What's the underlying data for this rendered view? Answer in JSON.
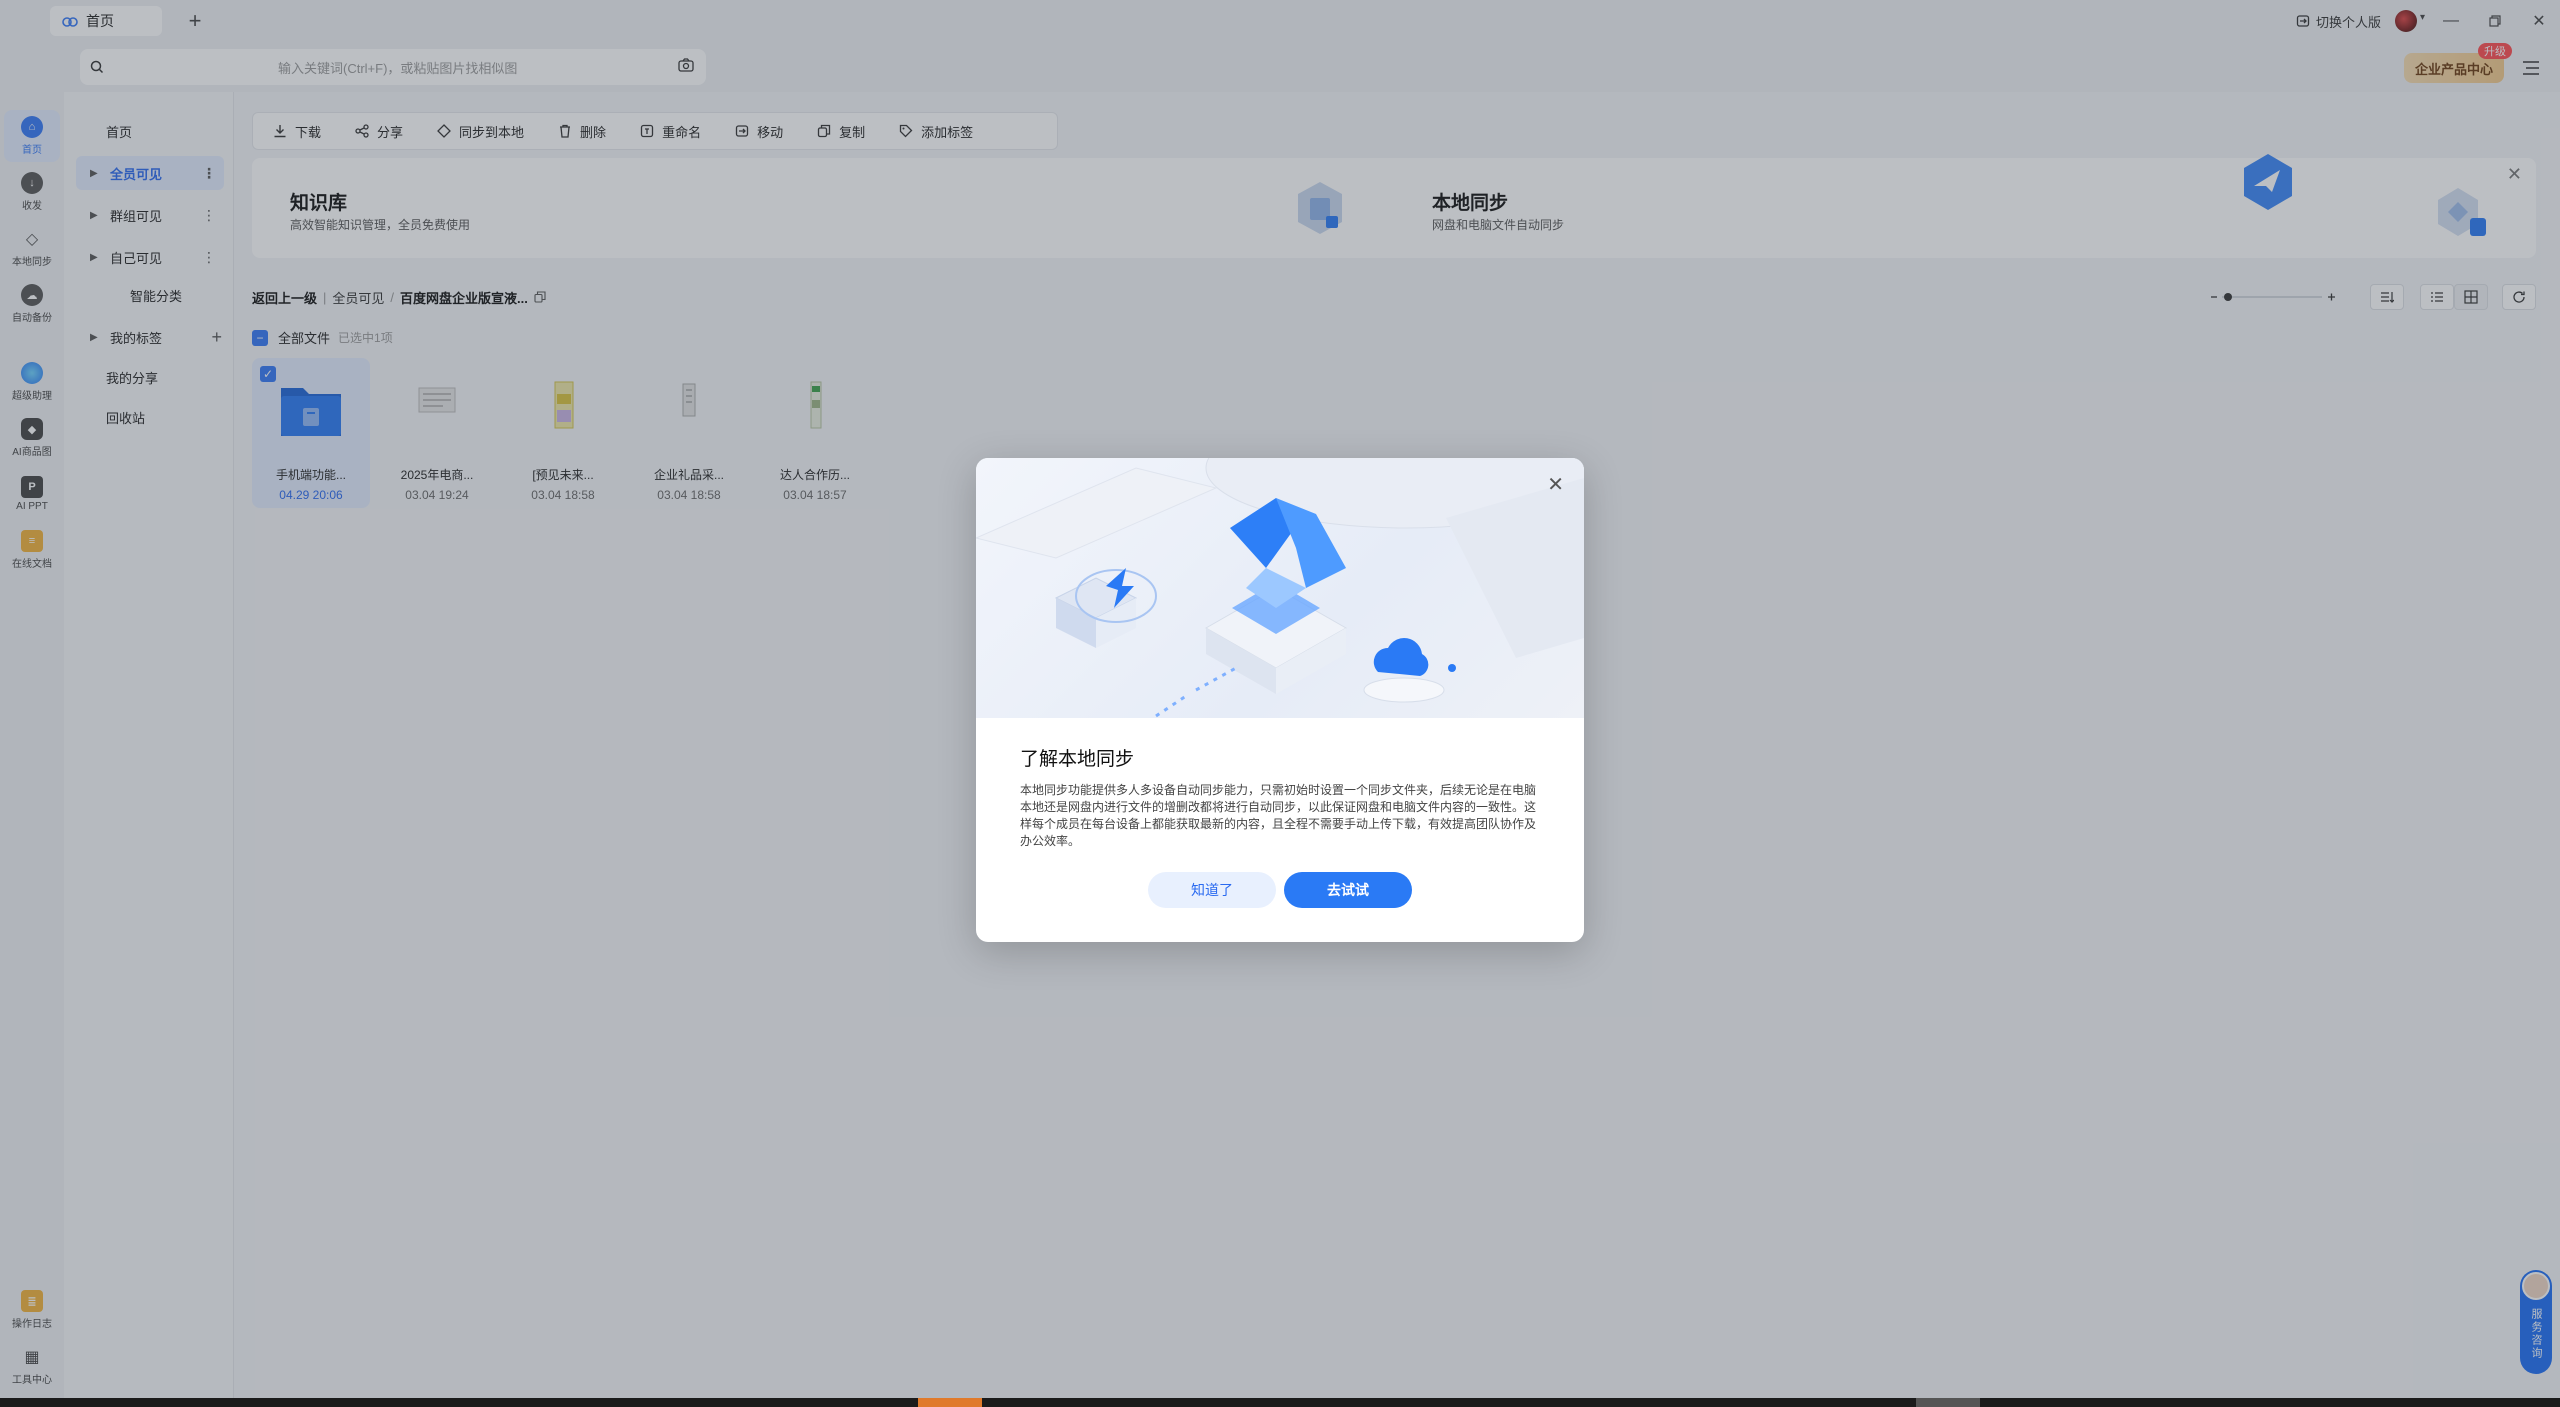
{
  "titlebar": {
    "tab_label": "首页",
    "switch_personal": "切换个人版"
  },
  "search": {
    "placeholder": "输入关键词(Ctrl+F)，或粘贴图片找相似图"
  },
  "header": {
    "enterprise_center": "企业产品中心",
    "upgrade_badge": "升级"
  },
  "rail": {
    "items": [
      {
        "label": "首页",
        "icon": "home-icon"
      },
      {
        "label": "收发",
        "icon": "inbox-icon"
      },
      {
        "label": "本地同步",
        "icon": "sync-icon"
      },
      {
        "label": "自动备份",
        "icon": "cloud-backup-icon"
      },
      {
        "label": "超级助理",
        "icon": "assistant-icon"
      },
      {
        "label": "AI商品图",
        "icon": "ai-product-icon"
      },
      {
        "label": "AI PPT",
        "icon": "ppt-icon"
      },
      {
        "label": "在线文档",
        "icon": "doc-icon"
      },
      {
        "label": "操作日志",
        "icon": "log-icon"
      },
      {
        "label": "工具中心",
        "icon": "tools-icon"
      }
    ]
  },
  "sidebar": {
    "home": "首页",
    "all_visible": "全员可见",
    "group_visible": "群组可见",
    "self_visible": "自己可见",
    "smart_category": "智能分类",
    "my_tags": "我的标签",
    "my_share": "我的分享",
    "recycle": "回收站"
  },
  "toolbar": {
    "download": "下载",
    "share": "分享",
    "sync_local": "同步到本地",
    "delete": "删除",
    "rename": "重命名",
    "move": "移动",
    "copy": "复制",
    "add_tag": "添加标签"
  },
  "banner": {
    "kb_title": "知识库",
    "kb_sub": "高效智能知识管理，全员免费使用",
    "sync_title": "本地同步",
    "sync_sub": "网盘和电脑文件自动同步"
  },
  "breadcrumb": {
    "back": "返回上一级",
    "level1": "全员可见",
    "current": "百度网盘企业版宣液..."
  },
  "list": {
    "all_files": "全部文件",
    "selected_info": "已选中1项"
  },
  "files": [
    {
      "name": "手机端功能...",
      "date": "04.29 20:06",
      "selected": true
    },
    {
      "name": "2025年电商...",
      "date": "03.04 19:24",
      "selected": false
    },
    {
      "name": "[预见未来...",
      "date": "03.04 18:58",
      "selected": false
    },
    {
      "name": "企业礼品采...",
      "date": "03.04 18:58",
      "selected": false
    },
    {
      "name": "达人合作历...",
      "date": "03.04 18:57",
      "selected": false
    }
  ],
  "service": {
    "label": "服务咨询"
  },
  "modal": {
    "title": "了解本地同步",
    "body": "本地同步功能提供多人多设备自动同步能力，只需初始时设置一个同步文件夹，后续无论是在电脑本地还是网盘内进行文件的增删改都将进行自动同步，以此保证网盘和电脑文件内容的一致性。这样每个成员在每台设备上都能获取最新的内容，且全程不需要手动上传下载，有效提高团队协作及办公效率。",
    "btn_know": "知道了",
    "btn_try": "去试试"
  },
  "colors": {
    "accent": "#3478f6",
    "primary_button": "#2a7af5"
  }
}
